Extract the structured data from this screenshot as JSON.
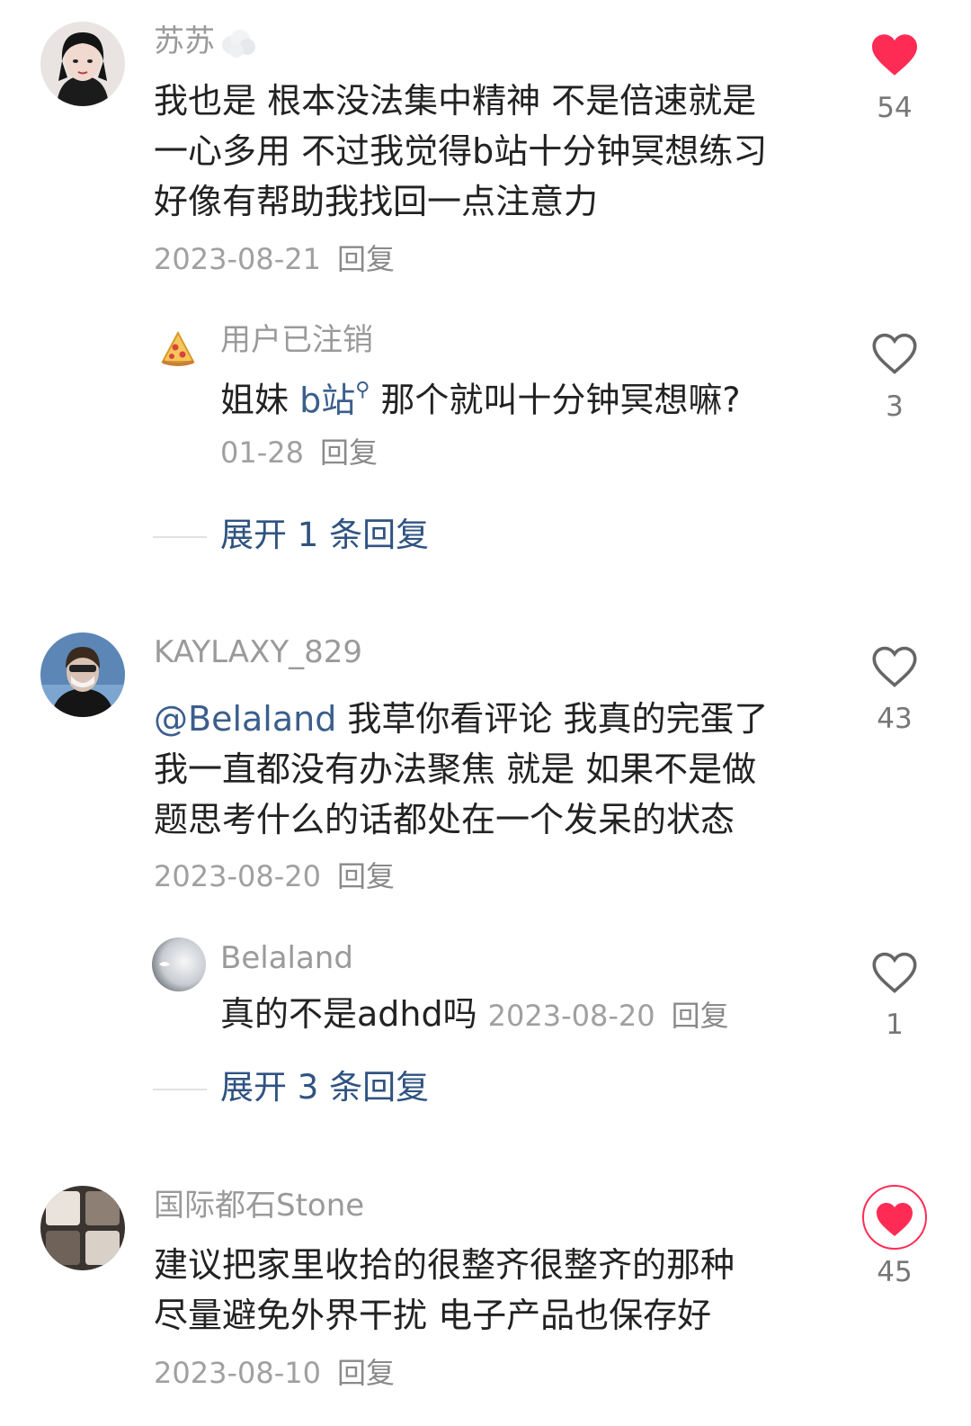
{
  "comments": [
    {
      "username": "苏苏",
      "lines": [
        "我也是 根本没法集中精神 不是倍速就是",
        "一心多用 不过我觉得b站十分钟冥想练习",
        "好像有帮助我找回一点注意力"
      ],
      "date": "2023-08-21",
      "reply_label": "回复",
      "like_count": "54",
      "liked": true,
      "replies": [
        {
          "username": "用户已注销",
          "text_prefix": "姐妹 ",
          "search_term": "b站",
          "text_suffix": " 那个就叫十分钟冥想嘛?",
          "date": "01-28",
          "reply_label": "回复",
          "like_count": "3",
          "liked": false
        }
      ],
      "expand_label": "展开 1 条回复"
    },
    {
      "username": "KAYLAXY_829",
      "mention": "@Belaland",
      "lines": [
        " 我草你看评论 我真的完蛋了",
        "我一直都没有办法聚焦 就是 如果不是做",
        "题思考什么的话都处在一个发呆的状态"
      ],
      "date": "2023-08-20",
      "reply_label": "回复",
      "like_count": "43",
      "liked": false,
      "replies": [
        {
          "username": "Belaland",
          "text": "真的不是adhd吗",
          "date": "2023-08-20",
          "reply_label": "回复",
          "like_count": "1",
          "liked": false
        }
      ],
      "expand_label": "展开 3 条回复"
    },
    {
      "username": "国际都石Stone",
      "lines": [
        "建议把家里收拾的很整齐很整齐的那种",
        "尽量避免外界干扰 电子产品也保存好"
      ],
      "date": "2023-08-10",
      "reply_label": "回复",
      "like_count": "45",
      "liked": true
    }
  ],
  "colors": {
    "like_active": "#fe2c55",
    "like_outline": "#666666",
    "link_blue": "#2f5381",
    "meta_gray": "#a0a0a0"
  },
  "icons": {
    "liked": "heart-filled-icon",
    "unliked": "heart-outline-icon",
    "search": "search-icon"
  }
}
